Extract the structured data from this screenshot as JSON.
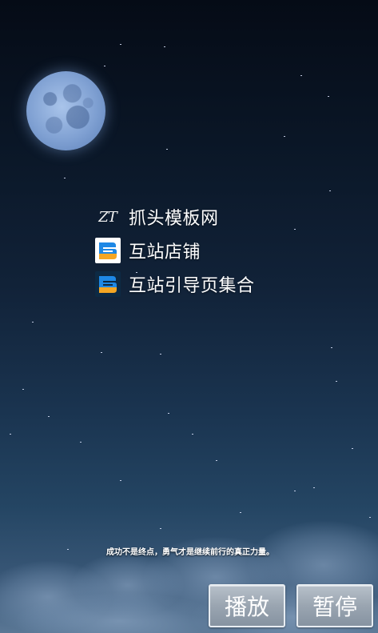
{
  "links": [
    {
      "label": "抓头模板网",
      "icon": "zt-logo-icon",
      "logo_text": "ZT"
    },
    {
      "label": "互站店铺",
      "icon": "huzhan-logo-icon"
    },
    {
      "label": "互站引导页集合",
      "icon": "huzhan-logo-dark-icon"
    }
  ],
  "slogan": "成功不是终点，勇气才是继续前行的真正力量。",
  "controls": {
    "play_label": "播放",
    "pause_label": "暂停"
  },
  "colors": {
    "sky_top": "#050b16",
    "sky_bottom": "#5a7795",
    "moon": "#7fa0d2",
    "button": "#9aa5b1",
    "huzhan_blue": "#1e88e5",
    "huzhan_orange": "#f5a623"
  }
}
